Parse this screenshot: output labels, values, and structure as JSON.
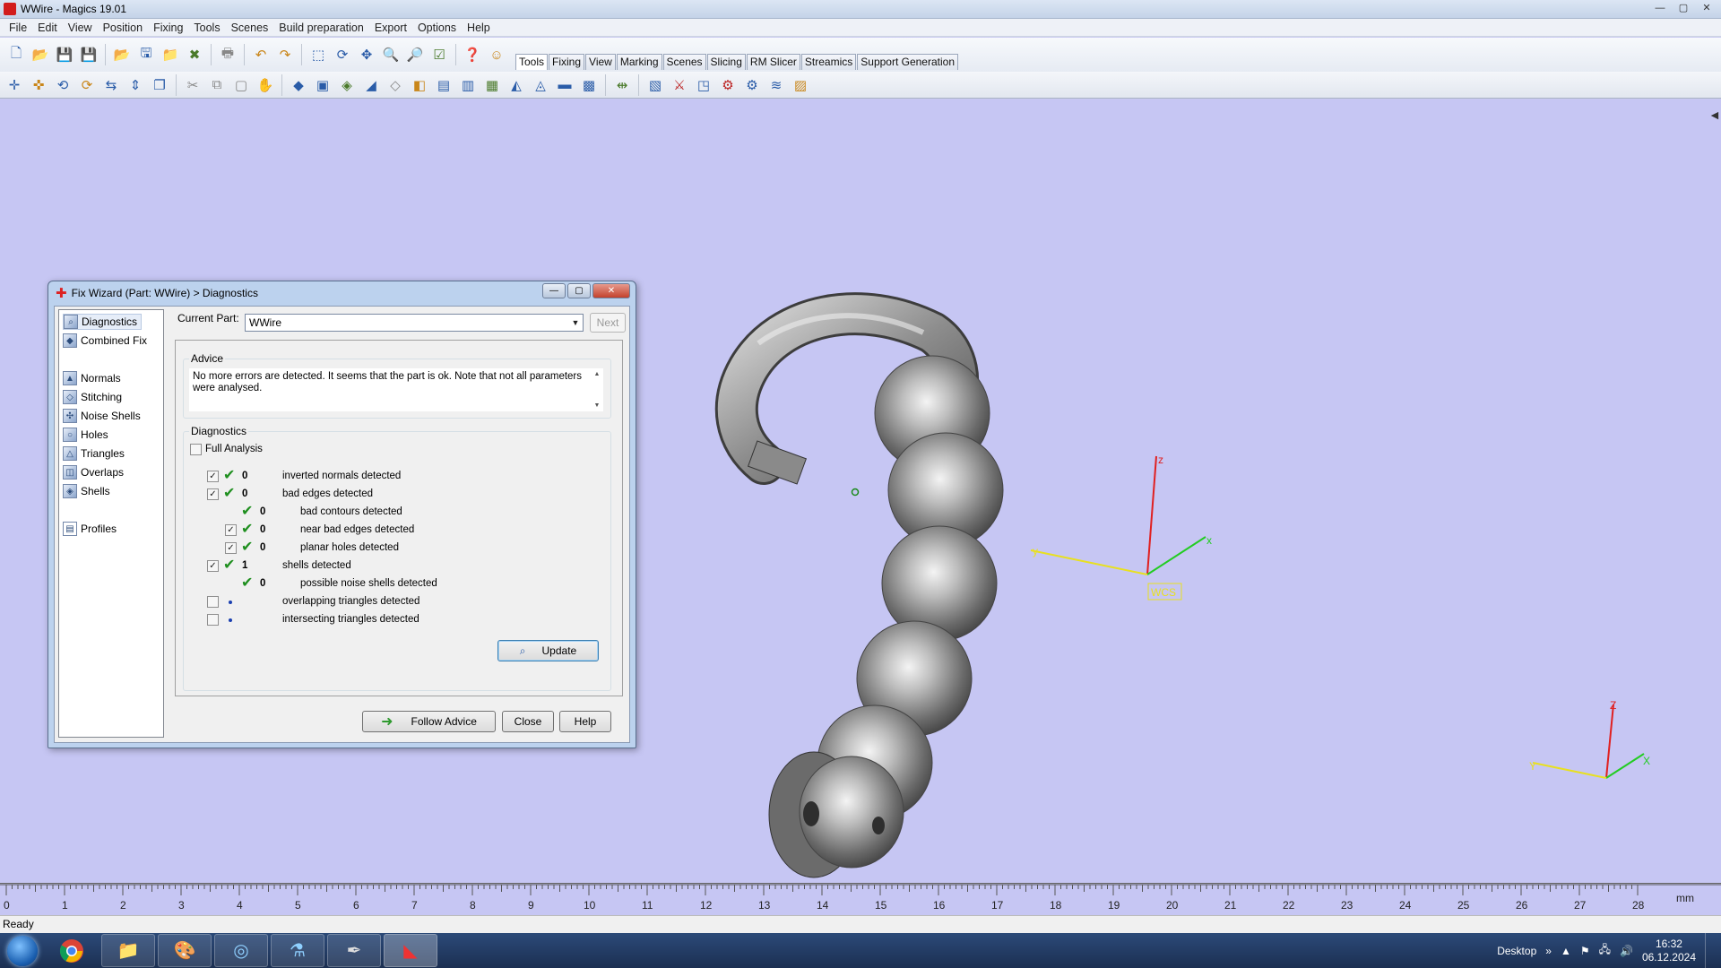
{
  "window": {
    "title": "WWire - Magics 19.01",
    "min": "—",
    "max": "▢",
    "close": "✕"
  },
  "menu": [
    "File",
    "Edit",
    "View",
    "Position",
    "Fixing",
    "Tools",
    "Scenes",
    "Build preparation",
    "Export",
    "Options",
    "Help"
  ],
  "toolbar_tabs": [
    {
      "label": "Tools",
      "active": true
    },
    {
      "label": "Fixing"
    },
    {
      "label": "View"
    },
    {
      "label": "Marking"
    },
    {
      "label": "Scenes"
    },
    {
      "label": "Slicing"
    },
    {
      "label": "RM Slicer"
    },
    {
      "label": "Streamics"
    },
    {
      "label": "Support Generation"
    }
  ],
  "dialog": {
    "title": "Fix Wizard (Part: WWire) > Diagnostics",
    "current_part_label": "Current Part:",
    "current_part_value": "WWire",
    "next_label": "Next",
    "nav_items": [
      {
        "label": "Diagnostics",
        "icon": "magnifier-icon",
        "selected": true
      },
      {
        "label": "Combined Fix",
        "icon": "combined-fix-icon"
      },
      {
        "label": "Normals",
        "icon": "normals-icon"
      },
      {
        "label": "Stitching",
        "icon": "stitching-icon"
      },
      {
        "label": "Noise Shells",
        "icon": "noise-shells-icon"
      },
      {
        "label": "Holes",
        "icon": "holes-icon"
      },
      {
        "label": "Triangles",
        "icon": "triangles-icon"
      },
      {
        "label": "Overlaps",
        "icon": "overlaps-icon"
      },
      {
        "label": "Shells",
        "icon": "shells-icon"
      },
      {
        "label": "Profiles",
        "icon": "profiles-icon"
      }
    ],
    "advice_title": "Advice",
    "advice_text": "No more errors are detected. It seems that the part is ok. Note that not all parameters were analysed.",
    "diagnostics_title": "Diagnostics",
    "full_analysis_label": "Full Analysis",
    "rows": [
      {
        "count": "0",
        "label": "inverted normals detected",
        "checked": true,
        "level": 0,
        "status": "ok"
      },
      {
        "count": "0",
        "label": "bad edges detected",
        "checked": true,
        "level": 0,
        "status": "ok"
      },
      {
        "count": "0",
        "label": "bad contours detected",
        "checked": null,
        "level": 1,
        "status": "ok"
      },
      {
        "count": "0",
        "label": "near bad edges detected",
        "checked": true,
        "level": 1,
        "status": "ok"
      },
      {
        "count": "0",
        "label": "planar holes detected",
        "checked": true,
        "level": 1,
        "status": "ok"
      },
      {
        "count": "1",
        "label": "shells detected",
        "checked": true,
        "level": 0,
        "status": "ok"
      },
      {
        "count": "0",
        "label": "possible noise shells detected",
        "checked": null,
        "level": 1,
        "status": "ok"
      },
      {
        "count": "",
        "label": "overlapping triangles detected",
        "checked": false,
        "level": 0,
        "status": "dot"
      },
      {
        "count": "",
        "label": "intersecting triangles detected",
        "checked": false,
        "level": 0,
        "status": "dot"
      }
    ],
    "update_label": "Update",
    "follow_label": "Follow Advice",
    "close_label": "Close",
    "help_label": "Help"
  },
  "viewport": {
    "axes_main": {
      "x": "x",
      "y": "y",
      "z": "z",
      "wcs": "WCS"
    },
    "axes_corner": {
      "x": "X",
      "y": "Y",
      "z": "Z"
    },
    "colors": {
      "background": "#c6c6f3",
      "x_axis": "#22cc22",
      "y_axis": "#e8e020",
      "z_axis": "#e02020"
    }
  },
  "ruler": {
    "ticks": [
      "0",
      "1",
      "2",
      "3",
      "4",
      "5",
      "6",
      "7",
      "8",
      "9",
      "10",
      "11",
      "12",
      "13",
      "14",
      "15",
      "16",
      "17",
      "18",
      "19",
      "20",
      "21",
      "22",
      "23",
      "24",
      "25",
      "26",
      "27",
      "28"
    ],
    "unit": "mm"
  },
  "status_text": "Ready",
  "taskbar": {
    "desktop_label": "Desktop",
    "time": "16:32",
    "date": "06.12.2024",
    "chevron": "»"
  }
}
